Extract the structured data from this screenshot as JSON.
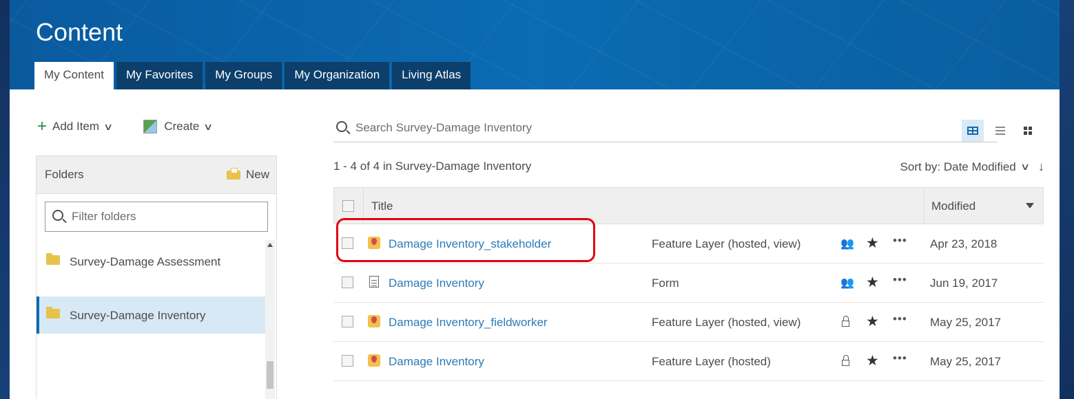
{
  "header": {
    "title": "Content",
    "tabs": [
      {
        "label": "My Content",
        "active": true
      },
      {
        "label": "My Favorites",
        "active": false
      },
      {
        "label": "My Groups",
        "active": false
      },
      {
        "label": "My Organization",
        "active": false
      },
      {
        "label": "Living Atlas",
        "active": false
      }
    ]
  },
  "toolbar": {
    "add_item": "Add Item",
    "create": "Create",
    "search_placeholder": "Search Survey-Damage Inventory"
  },
  "folders": {
    "title": "Folders",
    "new_label": "New",
    "filter_placeholder": "Filter folders",
    "items": [
      {
        "name": "Survey-Damage Assessment",
        "selected": false
      },
      {
        "name": "Survey-Damage Inventory",
        "selected": true
      }
    ]
  },
  "results": {
    "count_text": "1 - 4 of 4 in Survey-Damage Inventory",
    "sort_label": "Sort by: Date Modified"
  },
  "table": {
    "title_header": "Title",
    "modified_header": "Modified",
    "rows": [
      {
        "title": "Damage Inventory_stakeholder",
        "type": "Feature Layer (hosted, view)",
        "icon": "feature-layer-icon",
        "sharing": "shared-icon",
        "date": "Apr 23, 2018",
        "highlighted": true
      },
      {
        "title": "Damage Inventory",
        "type": "Form",
        "icon": "form-icon",
        "sharing": "shared-icon",
        "date": "Jun 19, 2017",
        "highlighted": false
      },
      {
        "title": "Damage Inventory_fieldworker",
        "type": "Feature Layer (hosted, view)",
        "icon": "feature-layer-icon",
        "sharing": "lock-icon",
        "date": "May 25, 2017",
        "highlighted": false
      },
      {
        "title": "Damage Inventory",
        "type": "Feature Layer (hosted)",
        "icon": "feature-layer-icon",
        "sharing": "lock-icon",
        "date": "May 25, 2017",
        "highlighted": false
      }
    ]
  },
  "colors": {
    "accent": "#0b6bb3",
    "link": "#2b7cb8",
    "highlight": "#e0000f",
    "tab_dark": "#0c3f6b"
  }
}
